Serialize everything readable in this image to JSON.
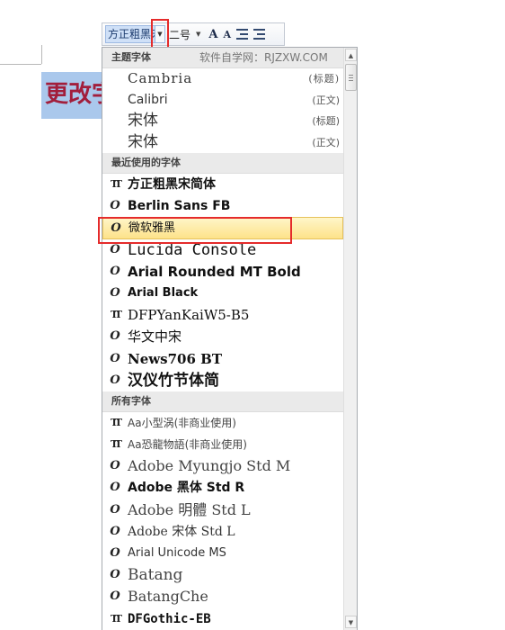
{
  "document": {
    "visible_text": "更改字"
  },
  "toolbar": {
    "font_name": "方正粗黑宋简体",
    "font_size": "二号",
    "grow_font": "A",
    "shrink_font": "A"
  },
  "dropdown": {
    "theme_section": {
      "title": "主题字体",
      "watermark": "软件自学网：RJZXW.COM",
      "items": [
        {
          "name": "Cambria",
          "tag": "(标题)"
        },
        {
          "name": "Calibri",
          "tag": "(正文)"
        },
        {
          "name": "宋体",
          "tag": "(标题)"
        },
        {
          "name": "宋体",
          "tag": "(正文)"
        }
      ]
    },
    "recent_section": {
      "title": "最近使用的字体",
      "items": [
        {
          "name": "方正粗黑宋简体",
          "icon": "truetype-icon"
        },
        {
          "name": "Berlin Sans FB",
          "icon": "opentype-icon"
        },
        {
          "name": "微软雅黑",
          "icon": "opentype-icon"
        },
        {
          "name": "Lucida Console",
          "icon": "opentype-icon"
        },
        {
          "name": "Arial Rounded MT Bold",
          "icon": "opentype-icon"
        },
        {
          "name": "Arial Black",
          "icon": "opentype-icon"
        },
        {
          "name": "DFPYanKaiW5-B5",
          "icon": "truetype-icon"
        },
        {
          "name": "华文中宋",
          "icon": "opentype-icon"
        },
        {
          "name": "News706 BT",
          "icon": "opentype-icon"
        },
        {
          "name": "汉仪竹节体简",
          "icon": "opentype-icon"
        }
      ]
    },
    "all_section": {
      "title": "所有字体",
      "items": [
        {
          "name": "Aa小型涡(非商业使用)",
          "icon": "truetype-icon"
        },
        {
          "name": "Aa恐龍物語(非商业使用)",
          "icon": "truetype-icon"
        },
        {
          "name": "Adobe Myungjo Std M",
          "icon": "opentype-icon"
        },
        {
          "name": "Adobe 黑体 Std R",
          "icon": "opentype-icon"
        },
        {
          "name": "Adobe 明體 Std L",
          "icon": "opentype-icon"
        },
        {
          "name": "Adobe 宋体 Std L",
          "icon": "opentype-icon"
        },
        {
          "name": "Arial Unicode MS",
          "icon": "opentype-icon"
        },
        {
          "name": "Batang",
          "icon": "opentype-icon"
        },
        {
          "name": "BatangChe",
          "icon": "opentype-icon"
        },
        {
          "name": "DFGothic-EB",
          "icon": "truetype-icon"
        }
      ]
    }
  },
  "colors": {
    "highlight_border": "#e52b2b",
    "selection_fill": "#aac8ec",
    "doc_text": "#a21e3c",
    "hover_row": "#fde28a"
  }
}
